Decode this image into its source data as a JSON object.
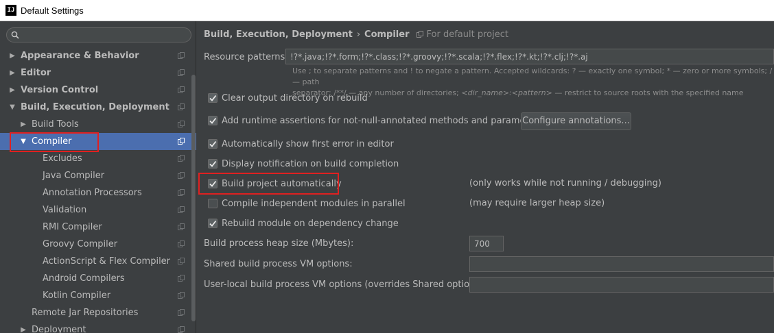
{
  "window": {
    "title": "Default Settings",
    "app_icon_text": "IJ"
  },
  "search": {
    "placeholder": "",
    "value": ""
  },
  "sidebar": {
    "items": [
      {
        "label": "Appearance & Behavior",
        "arrow": "▶",
        "level": 0,
        "bold": true,
        "selected": false
      },
      {
        "label": "Editor",
        "arrow": "▶",
        "level": 0,
        "bold": true,
        "selected": false
      },
      {
        "label": "Version Control",
        "arrow": "▶",
        "level": 0,
        "bold": true,
        "selected": false
      },
      {
        "label": "Build, Execution, Deployment",
        "arrow": "▼",
        "level": 0,
        "bold": true,
        "selected": false
      },
      {
        "label": "Build Tools",
        "arrow": "▶",
        "level": 1,
        "bold": false,
        "selected": false
      },
      {
        "label": "Compiler",
        "arrow": "▼",
        "level": 1,
        "bold": false,
        "selected": true
      },
      {
        "label": "Excludes",
        "arrow": "",
        "level": 2,
        "bold": false,
        "selected": false
      },
      {
        "label": "Java Compiler",
        "arrow": "",
        "level": 2,
        "bold": false,
        "selected": false
      },
      {
        "label": "Annotation Processors",
        "arrow": "",
        "level": 2,
        "bold": false,
        "selected": false
      },
      {
        "label": "Validation",
        "arrow": "",
        "level": 2,
        "bold": false,
        "selected": false
      },
      {
        "label": "RMI Compiler",
        "arrow": "",
        "level": 2,
        "bold": false,
        "selected": false
      },
      {
        "label": "Groovy Compiler",
        "arrow": "",
        "level": 2,
        "bold": false,
        "selected": false
      },
      {
        "label": "ActionScript & Flex Compiler",
        "arrow": "",
        "level": 2,
        "bold": false,
        "selected": false
      },
      {
        "label": "Android Compilers",
        "arrow": "",
        "level": 2,
        "bold": false,
        "selected": false
      },
      {
        "label": "Kotlin Compiler",
        "arrow": "",
        "level": 2,
        "bold": false,
        "selected": false
      },
      {
        "label": "Remote Jar Repositories",
        "arrow": "",
        "level": 1,
        "bold": false,
        "selected": false
      },
      {
        "label": "Deployment",
        "arrow": "▶",
        "level": 1,
        "bold": false,
        "selected": false
      }
    ]
  },
  "breadcrumb": {
    "section": "Build, Execution, Deployment",
    "separator": "›",
    "page": "Compiler",
    "scope": "For default project"
  },
  "resource_patterns": {
    "label": "Resource patterns:",
    "value": "!?*.java;!?*.form;!?*.class;!?*.groovy;!?*.scala;!?*.flex;!?*.kt;!?*.clj;!?*.aj",
    "hint_line1": "Use ; to separate patterns and ! to negate a pattern. Accepted wildcards: ? — exactly one symbol; * — zero or more symbols; / — path",
    "hint_line2_a": "separator; /**/ — any number of directories; ",
    "hint_line2_italic": "<dir_name>:<pattern>",
    "hint_line2_b": " — restrict to source roots with the specified name"
  },
  "options": {
    "clear_output": {
      "label": "Clear output directory on rebuild",
      "checked": true
    },
    "runtime_assertions": {
      "label": "Add runtime assertions for not-null-annotated methods and parameters",
      "checked": true
    },
    "configure_annotations": "Configure annotations...",
    "show_first_error": {
      "label": "Automatically show first error in editor",
      "checked": true
    },
    "display_notification": {
      "label": "Display notification on build completion",
      "checked": true
    },
    "build_automatically": {
      "label": "Build project automatically",
      "checked": true,
      "note": "(only works while not running / debugging)"
    },
    "compile_parallel": {
      "label": "Compile independent modules in parallel",
      "checked": false,
      "note": "(may require larger heap size)"
    },
    "rebuild_on_dependency": {
      "label": "Rebuild module on dependency change",
      "checked": true
    }
  },
  "heap_size": {
    "label": "Build process heap size (Mbytes):",
    "value": "700"
  },
  "shared_vm": {
    "label": "Shared build process VM options:",
    "value": ""
  },
  "local_vm": {
    "label": "User-local build process VM options (overrides Shared options):",
    "value": ""
  }
}
